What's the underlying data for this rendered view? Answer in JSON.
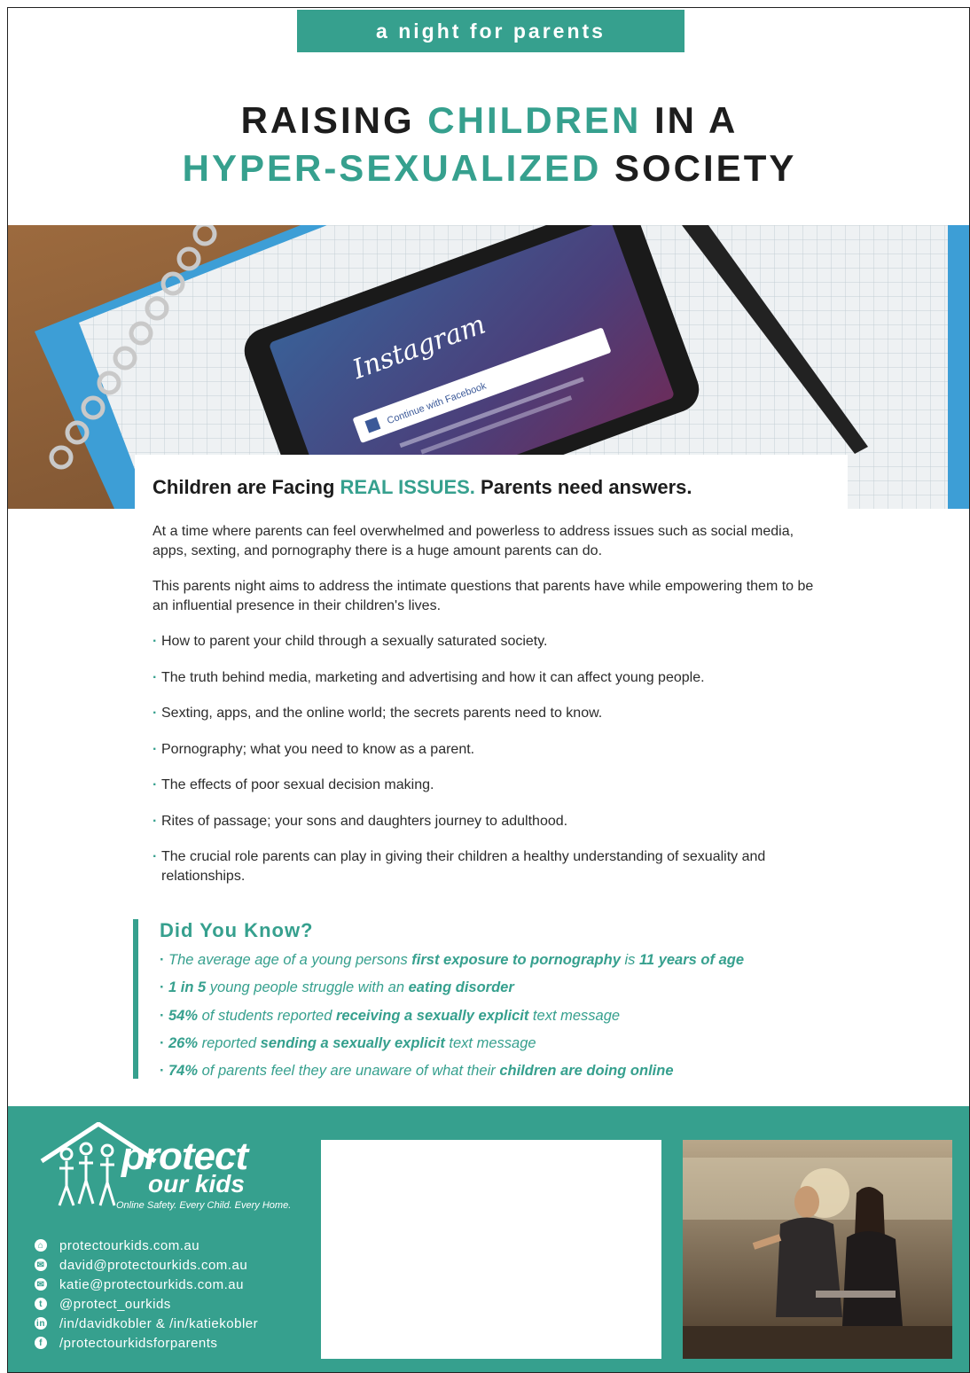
{
  "tagline": "a night for parents",
  "headline": {
    "line1_a": "RAISING ",
    "line1_b": "CHILDREN",
    "line1_c": " IN A",
    "line2_a": "HYPER-SEXUALIZED",
    "line2_b": " SOCIETY"
  },
  "hero": {
    "app_name": "Instagram",
    "button_text": "Continue with Facebook"
  },
  "intro": {
    "heading_a": "Children are Facing ",
    "heading_b": "REAL ISSUES.",
    "heading_c": " Parents need answers.",
    "para1": "At a time where parents can feel overwhelmed and powerless to address issues such as social media, apps, sexting, and pornography there is a huge amount parents can do.",
    "para2": "This parents night aims to address the intimate questions that parents have while empowering them to be an influential presence in their children's lives.",
    "bullets": [
      "How to parent your child through a sexually saturated society.",
      "The truth behind media, marketing and advertising and how it can affect young people.",
      "Sexting, apps, and the online world; the secrets parents need to know.",
      "Pornography; what you need to know as a parent.",
      "The effects of poor sexual decision making.",
      "Rites of passage; your sons and daughters journey to adulthood.",
      "The crucial role parents can play in giving their children a healthy understanding of sexuality and relationships."
    ]
  },
  "did_you_know": {
    "heading": "Did You Know?",
    "facts": [
      {
        "a": "The average age of a young persons ",
        "b": "first exposure to pornography",
        "c": " is ",
        "d": "11 years of age",
        "e": ""
      },
      {
        "a": "",
        "b": "1 in 5",
        "c": " young people struggle with an ",
        "d": "eating disorder",
        "e": ""
      },
      {
        "a": "",
        "b": "54%",
        "c": " of students reported ",
        "d": "receiving a sexually explicit",
        "e": " text message"
      },
      {
        "a": "",
        "b": "26%",
        "c": " reported ",
        "d": "sending a sexually explicit",
        "e": " text message"
      },
      {
        "a": "",
        "b": "74%",
        "c": " of parents feel they are unaware of what their ",
        "d": "children are doing online",
        "e": ""
      }
    ]
  },
  "footer": {
    "logo_word1": "protect",
    "logo_word2": "our kids",
    "logo_tagline": "Online Safety. Every Child. Every Home.",
    "contacts": [
      {
        "icon": "web-icon",
        "glyph": "⌂",
        "text": "protectourkids.com.au"
      },
      {
        "icon": "email-icon",
        "glyph": "✉",
        "text": "david@protectourkids.com.au"
      },
      {
        "icon": "email-icon",
        "glyph": "✉",
        "text": "katie@protectourkids.com.au"
      },
      {
        "icon": "twitter-icon",
        "glyph": "t",
        "text": "@protect_ourkids"
      },
      {
        "icon": "linkedin-icon",
        "glyph": "in",
        "text": "/in/davidkobler & /in/katiekobler"
      },
      {
        "icon": "facebook-icon",
        "glyph": "f",
        "text": "/protectourkidsforparents"
      }
    ]
  },
  "colors": {
    "accent": "#36a08e",
    "text": "#1d1d1d"
  }
}
